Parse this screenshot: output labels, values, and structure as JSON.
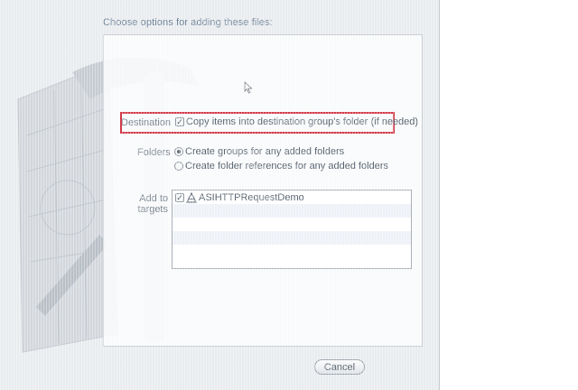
{
  "dialog": {
    "heading": "Choose options for adding these files:",
    "destination": {
      "label": "Destination",
      "checkbox_label": "Copy items into destination group's folder (if needed)",
      "checked": true
    },
    "folders": {
      "label": "Folders",
      "options": [
        {
          "label": "Create groups for any added folders",
          "selected": true
        },
        {
          "label": "Create folder references for any added folders",
          "selected": false
        }
      ]
    },
    "targets": {
      "label": "Add to targets",
      "items": [
        {
          "name": "ASIHTTPRequestDemo",
          "checked": true,
          "icon": "application-target-icon"
        }
      ]
    },
    "cancel_label": "Cancel"
  },
  "colors": {
    "highlight": "#d23a48",
    "label": "#7b8591",
    "heading": "#6a7f95"
  }
}
